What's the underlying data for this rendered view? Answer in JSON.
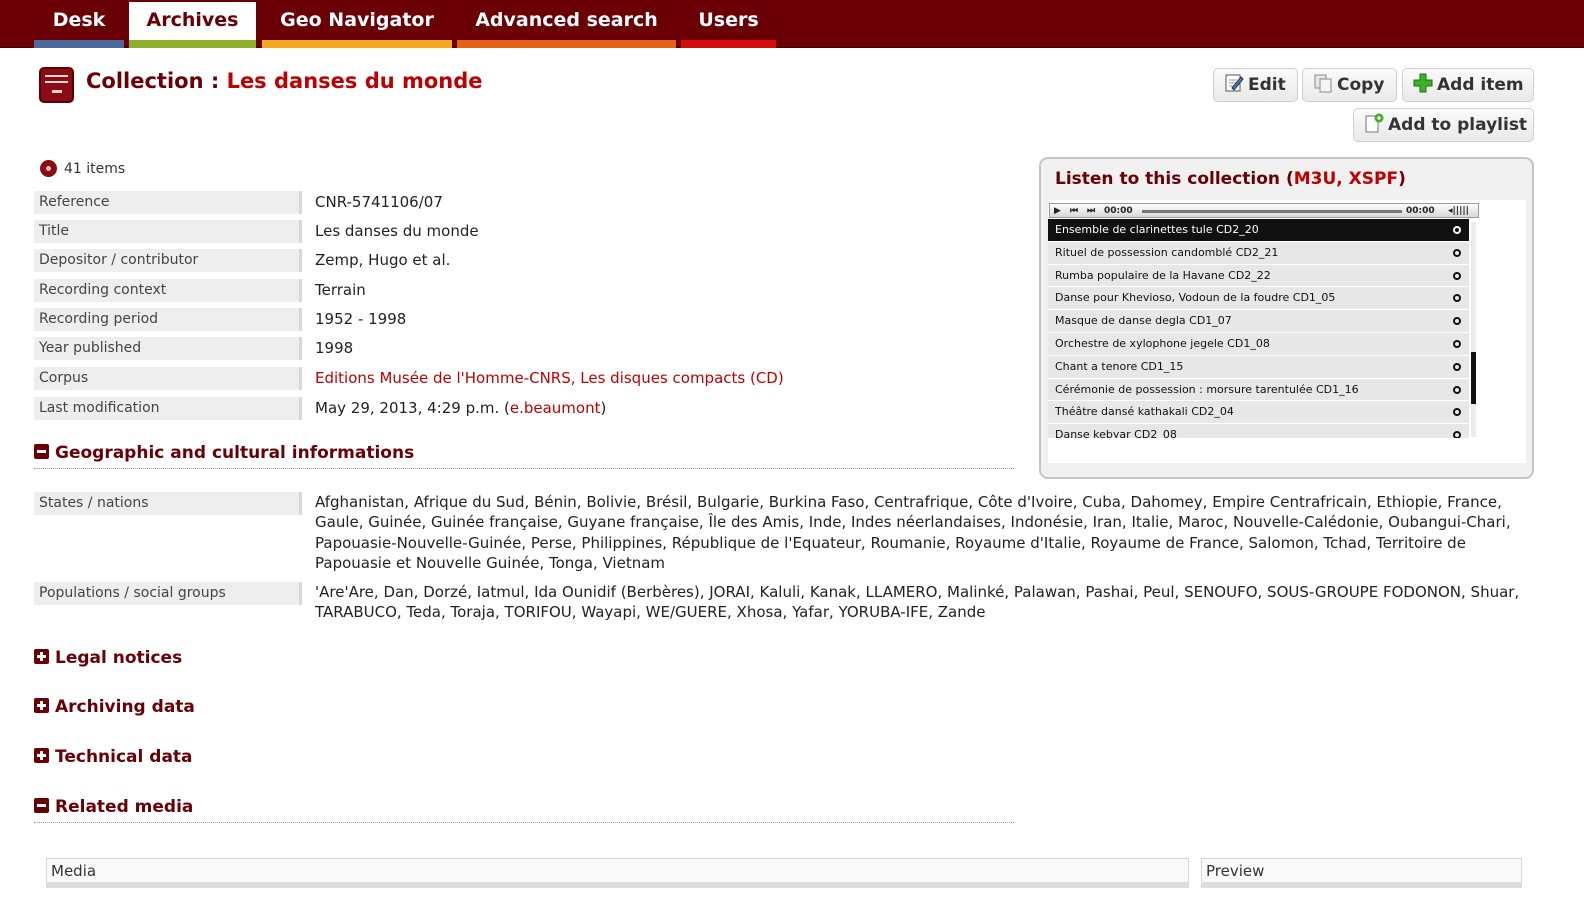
{
  "nav": {
    "tabs": [
      {
        "label": "Desk",
        "stripe": "#4b6a9c"
      },
      {
        "label": "Archives",
        "stripe": "#8fb02a",
        "active": true
      },
      {
        "label": "Geo Navigator",
        "stripe": "#f4a81c"
      },
      {
        "label": "Advanced search",
        "stripe": "#e46116"
      },
      {
        "label": "Users",
        "stripe": "#d50c0c"
      }
    ]
  },
  "header": {
    "prefix": "Collection : ",
    "name": "Les danses du monde"
  },
  "actions": {
    "edit": "Edit",
    "copy": "Copy",
    "add_item": "Add item",
    "add_playlist": "Add to playlist"
  },
  "summary": {
    "items": "41 items"
  },
  "fields": [
    {
      "label": "Reference",
      "value": "CNR-5741106/07"
    },
    {
      "label": "Title",
      "value": "Les danses du monde"
    },
    {
      "label": "Depositor / contributor",
      "value": "Zemp, Hugo et al."
    },
    {
      "label": "Recording context",
      "value": "Terrain"
    },
    {
      "label": "Recording period",
      "value": "1952 - 1998"
    },
    {
      "label": "Year published",
      "value": "1998"
    },
    {
      "label": "Corpus",
      "value": "Editions Musée de l'Homme-CNRS, Les disques compacts (CD)"
    },
    {
      "label": "Last modification",
      "value_prefix": "May 29, 2013, 4:29 p.m. (",
      "value_link": "e.beaumont",
      "value_suffix": ")"
    }
  ],
  "sections": {
    "geo": "Geographic and cultural informations",
    "legal": "Legal notices",
    "archiving": "Archiving data",
    "technical": "Technical data",
    "related": "Related media"
  },
  "geo_fields": [
    {
      "label": "States / nations",
      "value": "Afghanistan, Afrique du Sud, Bénin, Bolivie, Brésil, Bulgarie, Burkina Faso, Centrafrique, Côte d'Ivoire, Cuba, Dahomey, Empire Centrafricain, Ethiopie, France, Gaule, Guinée, Guinée française, Guyane française, Île des Amis, Inde, Indes néerlandaises, Indonésie, Iran, Italie, Maroc, Nouvelle-Calédonie, Oubangui-Chari, Papouasie-Nouvelle-Guinée, Perse, Philippines, République de l'Equateur, Roumanie, Royaume d'Italie, Royaume de France, Salomon, Tchad, Territoire de Papouasie et Nouvelle Guinée, Tonga, Vietnam"
    },
    {
      "label": "Populations / social groups",
      "value": "'Are'Are, Dan, Dorzé, Iatmul, Ida Ounidif (Berbères), JORAI, Kaluli, Kanak, LLAMERO, Malinké, Palawan, Pashai, Peul, SENOUFO, SOUS-GROUPE FODONON, Shuar, TARABUCO, Teda, Toraja, TORIFOU, Wayapi, WE/GUERE, Xhosa, Yafar, YORUBA-IFE, Zande"
    }
  ],
  "player": {
    "title_prefix": "Listen to this collection (",
    "m3u": "M3U",
    "sep": ", ",
    "xspf": "XSPF",
    "title_suffix": ")",
    "time_elapsed": "00:00",
    "time_total": "00:00",
    "tracks": [
      "Ensemble de clarinettes tule CD2_20",
      "Rituel de possession candomblé CD2_21",
      "Rumba populaire de la Havane CD2_22",
      "Danse pour Khevioso, Vodoun de la foudre CD1_05",
      "Masque de danse degla CD1_07",
      "Orchestre de xylophone jegele CD1_08",
      "Chant a tenore CD1_15",
      "Cérémonie de possession : morsure tarentulée CD1_16",
      "Théâtre dansé kathakali CD2_04",
      "Danse kebyar CD2_08"
    ]
  },
  "media_table": {
    "col_media": "Media",
    "col_preview": "Preview"
  }
}
